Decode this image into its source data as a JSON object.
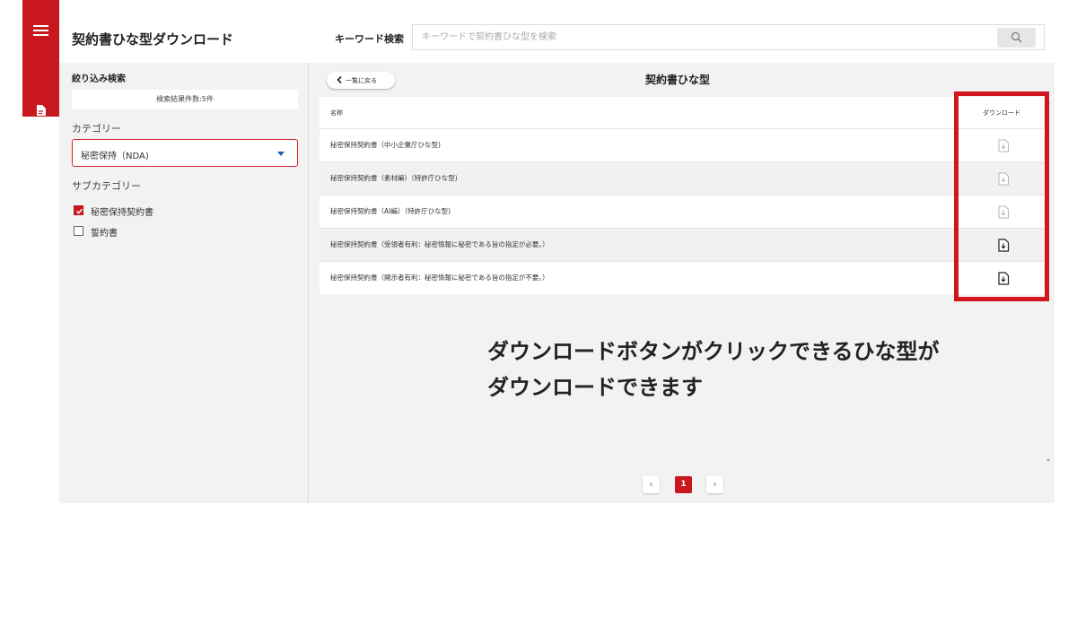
{
  "header": {
    "app_title": "契約書ひな型ダウンロード",
    "keyword_label": "キーワード検索",
    "search_placeholder": "キーワードで契約書ひな型を検索"
  },
  "sidebar": {
    "filter_title": "絞り込み検索",
    "result_count": "検索結果件数:5件",
    "category_label": "カテゴリー",
    "category_value": "秘密保持（NDA)",
    "subcategory_label": "サブカテゴリー",
    "subcategories": [
      {
        "label": "秘密保持契約書",
        "checked": true
      },
      {
        "label": "誓約書",
        "checked": false
      }
    ]
  },
  "main": {
    "back_label": "一覧に戻る",
    "title": "契約書ひな型",
    "table": {
      "col_name": "名称",
      "col_download": "ダウンロード",
      "rows": [
        {
          "name": "秘密保持契約書（中小企業庁ひな型)",
          "download_enabled": false
        },
        {
          "name": "秘密保持契約書（素材編）（特許庁ひな型)",
          "download_enabled": false
        },
        {
          "name": "秘密保持契約書（AI編）（特許庁ひな型)",
          "download_enabled": false
        },
        {
          "name": "秘密保持契約書（受領者有利：秘密情報に秘密である旨の指定が必要。）",
          "download_enabled": true
        },
        {
          "name": "秘密保持契約書（開示者有利：秘密情報に秘密である旨の指定が不要。）",
          "download_enabled": true
        }
      ]
    },
    "annotation_line1": "ダウンロードボタンがクリックできるひな型が",
    "annotation_line2": "ダウンロードできます",
    "pagination": {
      "prev": "‹",
      "current": "1",
      "next": "›"
    }
  },
  "icons": [
    "menu-icon",
    "document-icon",
    "search-icon",
    "chevron-left-icon",
    "download-file-icon",
    "checkbox-icon"
  ],
  "colors": {
    "brand": "#c8171d",
    "highlight": "#d1171d",
    "select_caret": "#1f5fb4"
  }
}
